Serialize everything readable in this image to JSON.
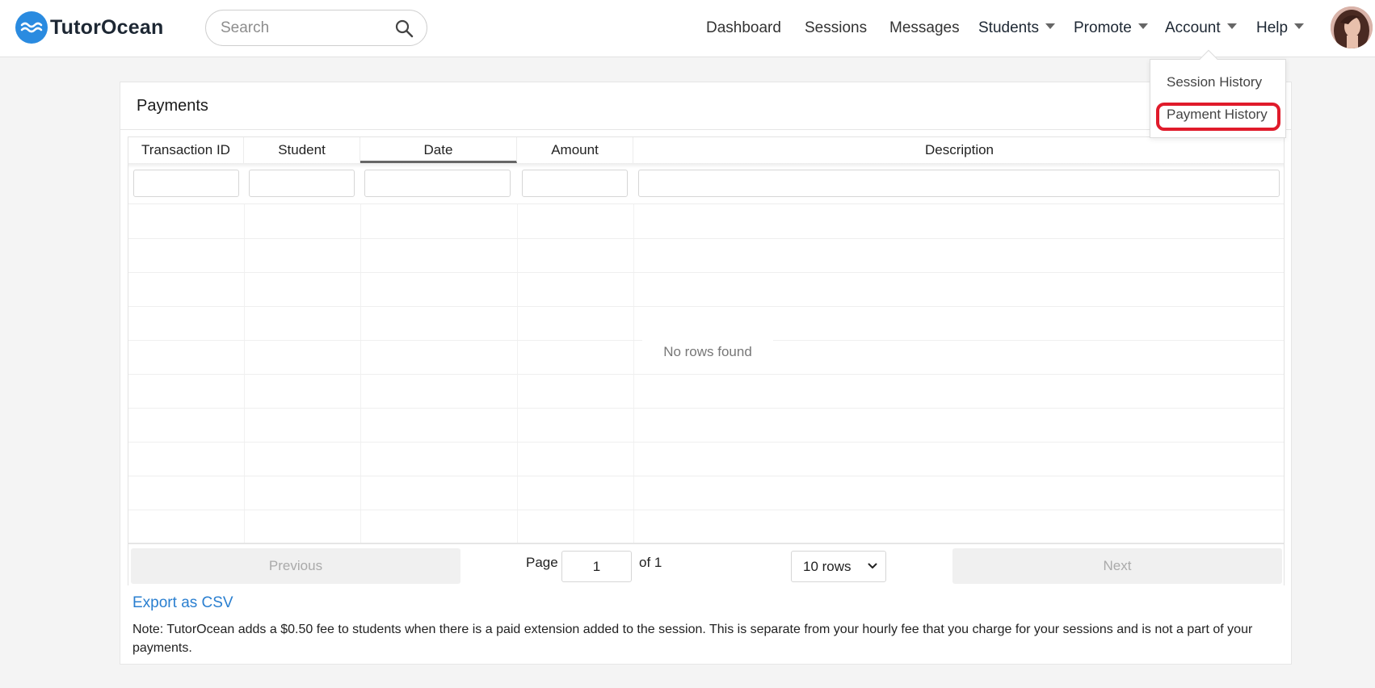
{
  "header": {
    "logo_text": "TutorOcean",
    "search_placeholder": "Search",
    "nav": {
      "dashboard": "Dashboard",
      "sessions": "Sessions",
      "messages": "Messages",
      "students": "Students",
      "promote": "Promote",
      "account": "Account",
      "help": "Help"
    }
  },
  "account_menu": {
    "items": [
      "Session History",
      "Payment History"
    ],
    "highlighted": "Payment History",
    "highlight_color": "#e01b2b"
  },
  "payments": {
    "title": "Payments",
    "columns": [
      "Transaction ID",
      "Student",
      "Date",
      "Amount",
      "Description"
    ],
    "sorted_column": "Date",
    "empty_text": "No rows found",
    "pagination": {
      "previous_label": "Previous",
      "page_label": "Page",
      "page_value": "1",
      "of_label": "of 1",
      "rows_label": "10 rows",
      "next_label": "Next"
    },
    "export_label": "Export as CSV",
    "note": "Note: TutorOcean adds a $0.50 fee to students when there is a paid extension added to the session. This is separate from your hourly fee that you charge for your sessions and is not a part of your payments."
  },
  "colors": {
    "brand": "#2a8be0",
    "link": "#2a7fd0"
  }
}
